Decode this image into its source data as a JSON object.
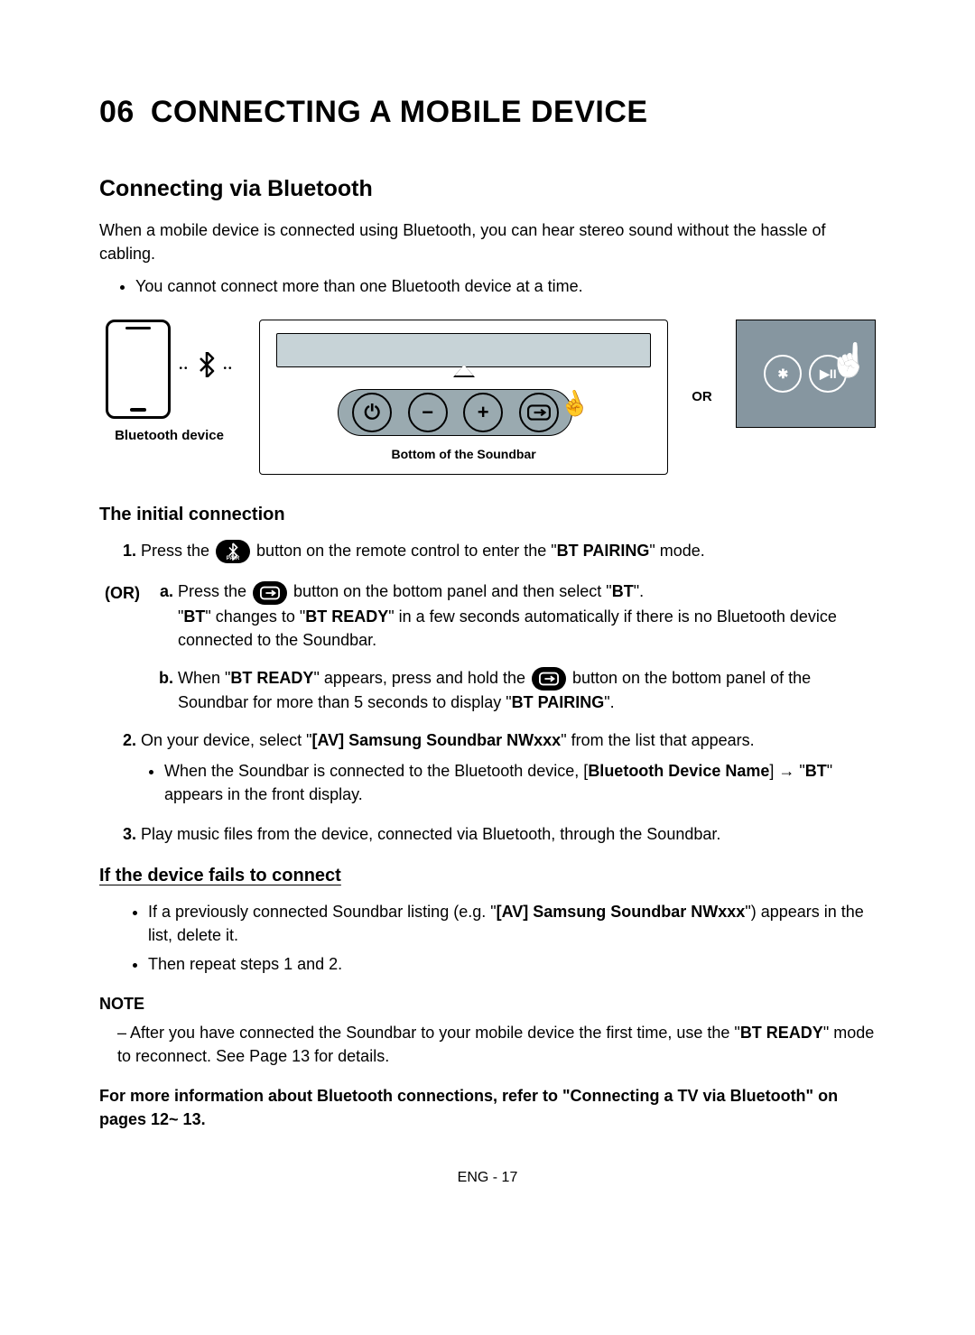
{
  "chapter": {
    "num": "06",
    "title": "CONNECTING A MOBILE DEVICE"
  },
  "section_title": "Connecting via Bluetooth",
  "intro": "When a mobile device is connected using Bluetooth, you can hear stereo sound without the hassle of cabling.",
  "intro_bullet": "You cannot connect more than one Bluetooth device at a time.",
  "figure": {
    "device_label": "Bluetooth device",
    "panel_label": "Bottom of the Soundbar",
    "or": "OR"
  },
  "initial_heading": "The initial connection",
  "step1": {
    "pre": "Press the ",
    "post": " button on the remote control to enter the \"",
    "bold": "BT PAIRING",
    "tail": "\" mode."
  },
  "or_label": "(OR)",
  "step_a": {
    "l1_pre": "Press the ",
    "l1_post": " button on the bottom panel and then select \"",
    "l1_bold": "BT",
    "l1_tail": "\".",
    "l2_pre": "\"",
    "l2_b1": "BT",
    "l2_mid": "\" changes to \"",
    "l2_b2": "BT READY",
    "l2_tail": "\" in a few seconds automatically if there is no Bluetooth device connected to the Soundbar."
  },
  "step_b": {
    "l1_pre": "When \"",
    "l1_b1": "BT READY",
    "l1_mid": "\" appears, press and hold the ",
    "l1_post": " button on the bottom panel of the Soundbar for more than 5 seconds to display \"",
    "l1_b2": "BT PAIRING",
    "l1_tail": "\"."
  },
  "step2": {
    "pre": "On your device, select \"",
    "bold": "[AV] Samsung Soundbar NWxxx",
    "tail": "\" from the list that appears.",
    "sub_pre": "When the Soundbar is connected to the Bluetooth device, [",
    "sub_b1": "Bluetooth Device Name",
    "sub_mid": "] → \"",
    "sub_b2": "BT",
    "sub_tail": "\" appears in the front display."
  },
  "step3": "Play music files from the device, connected via Bluetooth, through the Soundbar.",
  "fail_heading": "If the device fails to connect",
  "fail1_pre": "If a previously connected Soundbar listing (e.g. \"",
  "fail1_b": "[AV] Samsung Soundbar NWxxx",
  "fail1_tail": "\") appears in the list, delete it.",
  "fail2": "Then repeat steps 1 and 2.",
  "note_head": "NOTE",
  "note_pre": "After you have connected the Soundbar to your mobile device the first time, use the \"",
  "note_b": "BT READY",
  "note_tail": "\" mode to reconnect. See Page 13 for details.",
  "refer": "For more information about Bluetooth connections, refer to \"Connecting a TV via Bluetooth\" on pages 12~ 13.",
  "footer": "ENG - 17"
}
